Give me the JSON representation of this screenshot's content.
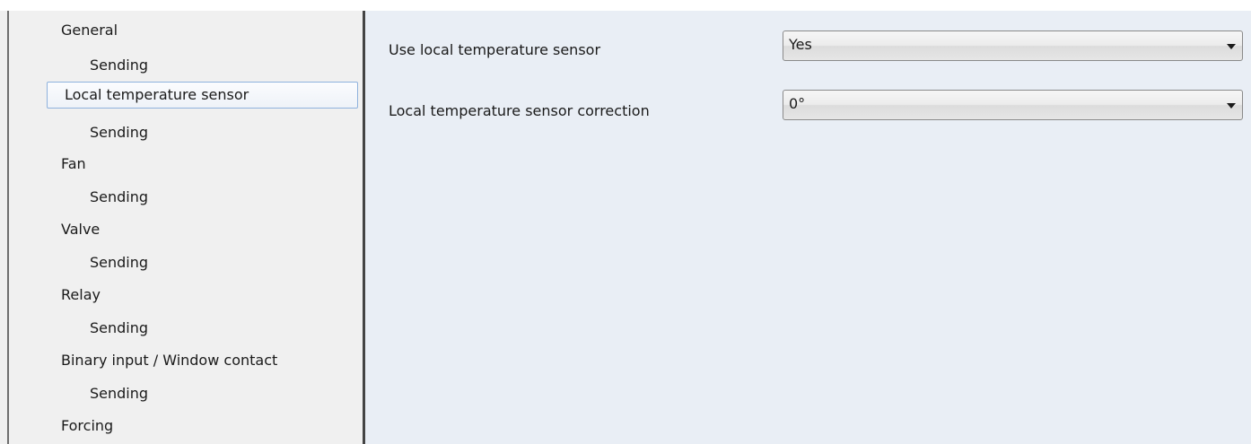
{
  "tree": {
    "items": [
      {
        "label": "General",
        "level": 0,
        "selected": false
      },
      {
        "label": "Sending",
        "level": 1,
        "selected": false
      },
      {
        "label": "Local temperature sensor",
        "level": 0,
        "selected": true
      },
      {
        "label": "Sending",
        "level": 1,
        "selected": false
      },
      {
        "label": "Fan",
        "level": 0,
        "selected": false
      },
      {
        "label": "Sending",
        "level": 1,
        "selected": false
      },
      {
        "label": "Valve",
        "level": 0,
        "selected": false
      },
      {
        "label": "Sending",
        "level": 1,
        "selected": false
      },
      {
        "label": "Relay",
        "level": 0,
        "selected": false
      },
      {
        "label": "Sending",
        "level": 1,
        "selected": false
      },
      {
        "label": "Binary input / Window contact",
        "level": 0,
        "selected": false
      },
      {
        "label": "Sending",
        "level": 1,
        "selected": false
      },
      {
        "label": "Forcing",
        "level": 0,
        "selected": false
      }
    ]
  },
  "parameters": [
    {
      "label": "Use local temperature sensor",
      "value": "Yes",
      "icon": "chevron-down-icon"
    },
    {
      "label": "Local temperature sensor correction",
      "value": "0°",
      "icon": "chevron-down-icon"
    }
  ]
}
